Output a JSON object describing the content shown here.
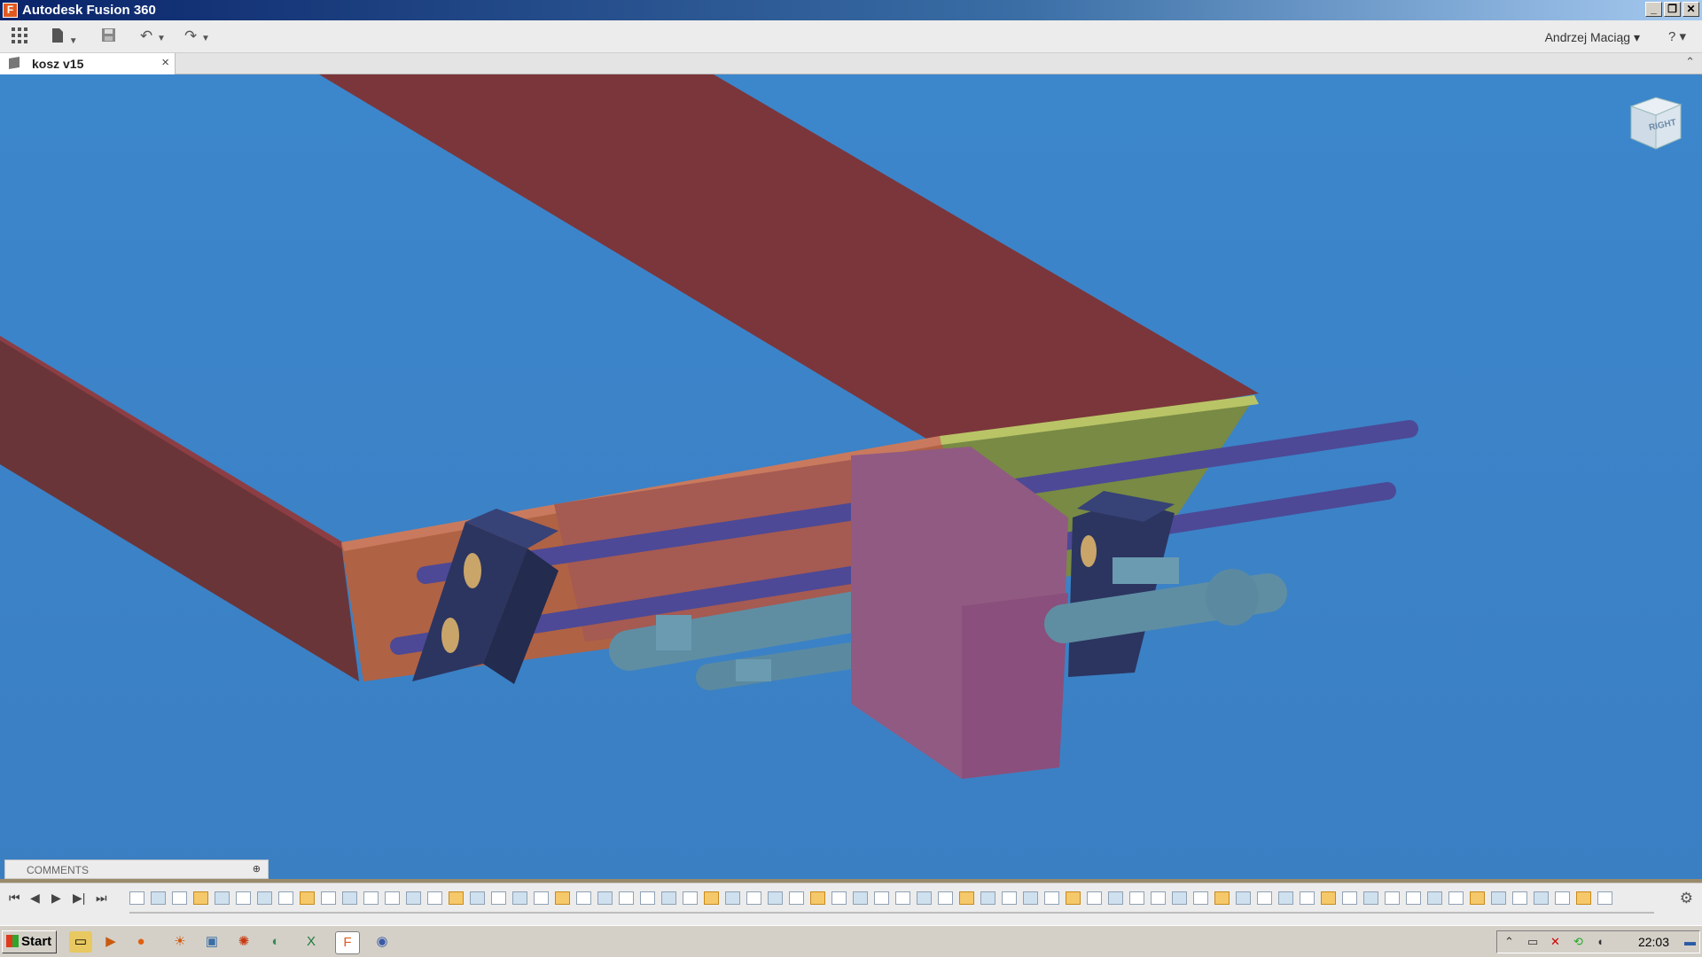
{
  "window": {
    "title": "Autodesk Fusion 360",
    "app_icon_letter": "F",
    "minimize": "_",
    "restore": "❐",
    "close": "✕"
  },
  "toolbar": {
    "data_panel_icon": "grid-icon",
    "file_icon": "▦",
    "save_icon": "💾",
    "undo_icon": "↶",
    "redo_icon": "↷",
    "user": "Andrzej Maciąg ▾",
    "help": "? ▾"
  },
  "document": {
    "tab_name": "kosz v15",
    "close_symbol": "×",
    "collapse_symbol": "⌃"
  },
  "viewcube": {
    "label": "RIGHT"
  },
  "comments": {
    "label": "COMMENTS",
    "add_symbol": "⊕"
  },
  "timeline": {
    "first": "⏮",
    "prev": "◀",
    "play": "▶",
    "next": "▶|",
    "last": "⏭",
    "settings": "⚙"
  },
  "taskbar": {
    "start": "Start",
    "clock": "22:03"
  },
  "colors": {
    "viewport": "#3b7fc2",
    "beam": "#7b363b",
    "end_plate": "#b06244",
    "mount_block": "#2b3560",
    "carriage": "#915a82",
    "rod": "#4d4996",
    "cylinder": "#5f8ea3"
  }
}
